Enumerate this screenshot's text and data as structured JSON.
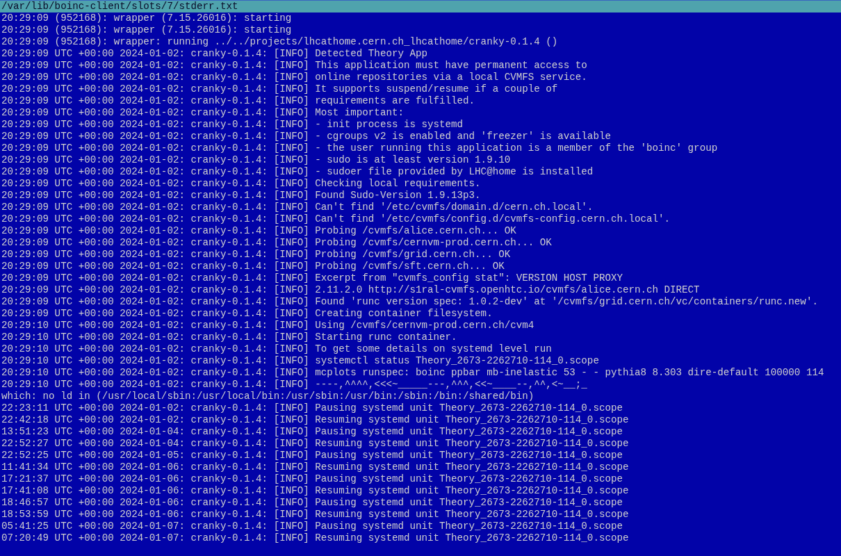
{
  "title_bar": {
    "path": "/var/lib/boinc-client/slots/7/stderr.txt"
  },
  "lines": [
    "20:29:09 (952168): wrapper (7.15.26016): starting",
    "20:29:09 (952168): wrapper (7.15.26016): starting",
    "20:29:09 (952168): wrapper: running ../../projects/lhcathome.cern.ch_lhcathome/cranky-0.1.4 ()",
    "20:29:09 UTC +00:00 2024-01-02: cranky-0.1.4: [INFO] Detected Theory App",
    "20:29:09 UTC +00:00 2024-01-02: cranky-0.1.4: [INFO] This application must have permanent access to",
    "20:29:09 UTC +00:00 2024-01-02: cranky-0.1.4: [INFO] online repositories via a local CVMFS service.",
    "20:29:09 UTC +00:00 2024-01-02: cranky-0.1.4: [INFO] It supports suspend/resume if a couple of",
    "20:29:09 UTC +00:00 2024-01-02: cranky-0.1.4: [INFO] requirements are fulfilled.",
    "20:29:09 UTC +00:00 2024-01-02: cranky-0.1.4: [INFO] Most important:",
    "20:29:09 UTC +00:00 2024-01-02: cranky-0.1.4: [INFO] - init process is systemd",
    "20:29:09 UTC +00:00 2024-01-02: cranky-0.1.4: [INFO] - cgroups v2 is enabled and 'freezer' is available",
    "20:29:09 UTC +00:00 2024-01-02: cranky-0.1.4: [INFO] - the user running this application is a member of the 'boinc' group",
    "20:29:09 UTC +00:00 2024-01-02: cranky-0.1.4: [INFO] - sudo is at least version 1.9.10",
    "20:29:09 UTC +00:00 2024-01-02: cranky-0.1.4: [INFO] - sudoer file provided by LHC@home is installed",
    "20:29:09 UTC +00:00 2024-01-02: cranky-0.1.4: [INFO] Checking local requirements.",
    "20:29:09 UTC +00:00 2024-01-02: cranky-0.1.4: [INFO] Found Sudo-Version 1.9.13p3.",
    "20:29:09 UTC +00:00 2024-01-02: cranky-0.1.4: [INFO] Can't find '/etc/cvmfs/domain.d/cern.ch.local'.",
    "20:29:09 UTC +00:00 2024-01-02: cranky-0.1.4: [INFO] Can't find '/etc/cvmfs/config.d/cvmfs-config.cern.ch.local'.",
    "20:29:09 UTC +00:00 2024-01-02: cranky-0.1.4: [INFO] Probing /cvmfs/alice.cern.ch... OK",
    "20:29:09 UTC +00:00 2024-01-02: cranky-0.1.4: [INFO] Probing /cvmfs/cernvm-prod.cern.ch... OK",
    "20:29:09 UTC +00:00 2024-01-02: cranky-0.1.4: [INFO] Probing /cvmfs/grid.cern.ch... OK",
    "20:29:09 UTC +00:00 2024-01-02: cranky-0.1.4: [INFO] Probing /cvmfs/sft.cern.ch... OK",
    "20:29:09 UTC +00:00 2024-01-02: cranky-0.1.4: [INFO] Excerpt from \"cvmfs_config stat\": VERSION HOST PROXY",
    "20:29:09 UTC +00:00 2024-01-02: cranky-0.1.4: [INFO] 2.11.2.0 http://s1ral-cvmfs.openhtc.io/cvmfs/alice.cern.ch DIRECT",
    "20:29:09 UTC +00:00 2024-01-02: cranky-0.1.4: [INFO] Found 'runc version spec: 1.0.2-dev' at '/cvmfs/grid.cern.ch/vc/containers/runc.new'.",
    "20:29:09 UTC +00:00 2024-01-02: cranky-0.1.4: [INFO] Creating container filesystem.",
    "20:29:10 UTC +00:00 2024-01-02: cranky-0.1.4: [INFO] Using /cvmfs/cernvm-prod.cern.ch/cvm4",
    "20:29:10 UTC +00:00 2024-01-02: cranky-0.1.4: [INFO] Starting runc container.",
    "20:29:10 UTC +00:00 2024-01-02: cranky-0.1.4: [INFO] To get some details on systemd level run",
    "20:29:10 UTC +00:00 2024-01-02: cranky-0.1.4: [INFO] systemctl status Theory_2673-2262710-114_0.scope",
    "20:29:10 UTC +00:00 2024-01-02: cranky-0.1.4: [INFO] mcplots runspec: boinc ppbar mb-inelastic 53 - - pythia8 8.303 dire-default 100000 114",
    "20:29:10 UTC +00:00 2024-01-02: cranky-0.1.4: [INFO] ----,^^^^,<<<~_____---,^^^,<<~____--,^^,<~__;_",
    "which: no ld in (/usr/local/sbin:/usr/local/bin:/usr/sbin:/usr/bin:/sbin:/bin:/shared/bin)",
    "22:23:11 UTC +00:00 2024-01-02: cranky-0.1.4: [INFO] Pausing systemd unit Theory_2673-2262710-114_0.scope",
    "22:42:18 UTC +00:00 2024-01-02: cranky-0.1.4: [INFO] Resuming systemd unit Theory_2673-2262710-114_0.scope",
    "13:51:23 UTC +00:00 2024-01-04: cranky-0.1.4: [INFO] Pausing systemd unit Theory_2673-2262710-114_0.scope",
    "22:52:27 UTC +00:00 2024-01-04: cranky-0.1.4: [INFO] Resuming systemd unit Theory_2673-2262710-114_0.scope",
    "22:52:25 UTC +00:00 2024-01-05: cranky-0.1.4: [INFO] Pausing systemd unit Theory_2673-2262710-114_0.scope",
    "11:41:34 UTC +00:00 2024-01-06: cranky-0.1.4: [INFO] Resuming systemd unit Theory_2673-2262710-114_0.scope",
    "17:21:37 UTC +00:00 2024-01-06: cranky-0.1.4: [INFO] Pausing systemd unit Theory_2673-2262710-114_0.scope",
    "17:41:08 UTC +00:00 2024-01-06: cranky-0.1.4: [INFO] Resuming systemd unit Theory_2673-2262710-114_0.scope",
    "18:46:57 UTC +00:00 2024-01-06: cranky-0.1.4: [INFO] Pausing systemd unit Theory_2673-2262710-114_0.scope",
    "18:53:59 UTC +00:00 2024-01-06: cranky-0.1.4: [INFO] Resuming systemd unit Theory_2673-2262710-114_0.scope",
    "05:41:25 UTC +00:00 2024-01-07: cranky-0.1.4: [INFO] Pausing systemd unit Theory_2673-2262710-114_0.scope",
    "07:20:49 UTC +00:00 2024-01-07: cranky-0.1.4: [INFO] Resuming systemd unit Theory_2673-2262710-114_0.scope"
  ]
}
